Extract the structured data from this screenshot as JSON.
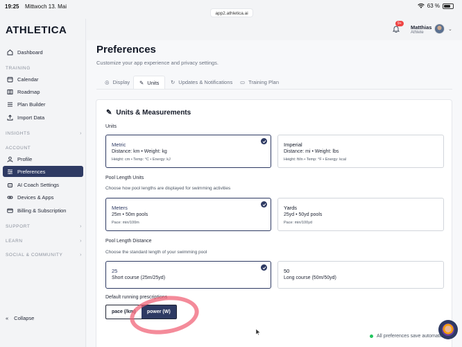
{
  "status": {
    "time": "19:25",
    "date": "Mittwoch 13. Mai",
    "url": "app2.athletica.ai",
    "battery": "63 %"
  },
  "app": {
    "logo": "ATHLETICA"
  },
  "sidebar": {
    "dashboard": "Dashboard",
    "training_label": "TRAINING",
    "training_items": [
      "Calendar",
      "Roadmap",
      "Plan Builder",
      "Import Data"
    ],
    "insights_label": "INSIGHTS",
    "account_label": "ACCOUNT",
    "account_items": [
      "Profile",
      "Preferences",
      "AI Coach Settings",
      "Devices & Apps",
      "Billing & Subscription"
    ],
    "support_label": "SUPPORT",
    "learn_label": "LEARN",
    "social_label": "SOCIAL & COMMUNITY",
    "collapse": "Collapse"
  },
  "user": {
    "name": "Matthias",
    "role": "Athlete",
    "badge": "9+"
  },
  "page": {
    "title": "Preferences",
    "subtitle": "Customize your app experience and privacy settings."
  },
  "tabs": [
    "Display",
    "Units",
    "Updates & Notifications",
    "Training Plan"
  ],
  "units": {
    "title": "Units & Measurements",
    "units_label": "Units",
    "metric": {
      "title": "Metric",
      "line": "Distance: km • Weight: kg",
      "detail": "Height: cm • Temp: °C • Energy: kJ"
    },
    "imperial": {
      "title": "Imperial",
      "line": "Distance: mi • Weight: lbs",
      "detail": "Height: ft/in • Temp: °F • Energy: kcal"
    },
    "pool_units_label": "Pool Length Units",
    "pool_units_desc": "Choose how pool lengths are displayed for swimming activities",
    "meters": {
      "title": "Meters",
      "line": "25m • 50m pools",
      "detail": "Pace: min/100m"
    },
    "yards": {
      "title": "Yards",
      "line": "25yd • 50yd pools",
      "detail": "Pace: min/100yd"
    },
    "pool_distance_label": "Pool Length Distance",
    "pool_distance_desc": "Choose the standard length of your swimming pool",
    "short": {
      "title": "25",
      "line": "Short course (25m/25yd)"
    },
    "long": {
      "title": "50",
      "line": "Long course (50m/50yd)"
    },
    "running_label": "Default running prescriptions",
    "pace_btn": "pace (/km)",
    "power_btn": "power (W)"
  },
  "footer": {
    "status": "All preferences save automatically"
  },
  "colors": {
    "accent": "#2e3a63",
    "success": "#22c55e",
    "badge": "#ef4444"
  }
}
